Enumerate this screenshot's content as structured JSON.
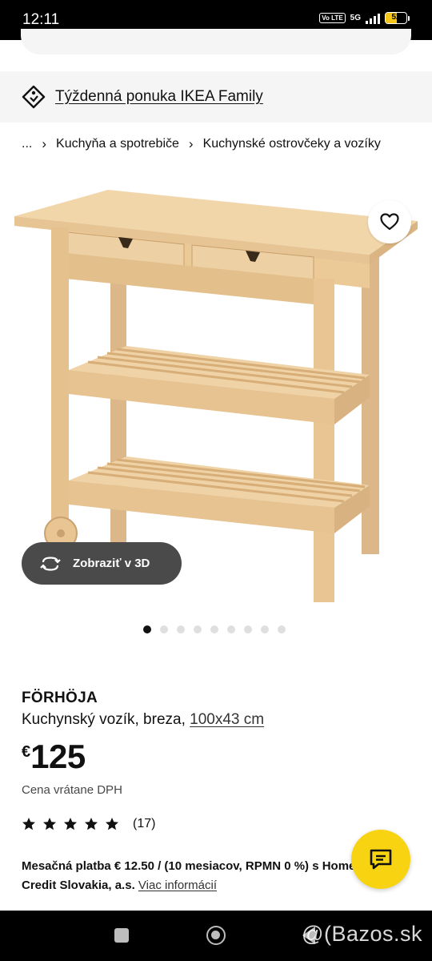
{
  "status_bar": {
    "time": "12:11",
    "volte": "Vo LTE",
    "network": "5G",
    "battery": "52",
    "battery_level": 0.52
  },
  "banner": {
    "link_label": "Týždenná ponuka IKEA Family",
    "icon": "price-tag-icon"
  },
  "breadcrumb": {
    "ellipsis": "...",
    "items": [
      "Kuchyňa a spotrebiče",
      "Kuchynské ostrovčeky a vozíky"
    ]
  },
  "gallery": {
    "view_3d_label": "Zobraziť v 3D",
    "dot_count": 9,
    "active_dot": 0
  },
  "product": {
    "name": "FÖRHÖJA",
    "description": "Kuchynský vozík, breza,",
    "dimensions": "100x43 cm",
    "currency": "€",
    "price": "125",
    "vat_note": "Cena vrátane DPH",
    "rating_stars": 5,
    "rating_count": "(17)",
    "installment_bold": "Mesačná platba € 12.50 / (10 mesiacov, RPMN 0 %) s Home Credit Slovakia, a.s.",
    "installment_link": "Viac informácií"
  },
  "nav": {
    "watermark": "@(Bazos.sk"
  },
  "colors": {
    "accent_yellow": "#f7d312",
    "dark_button": "#4a4a4a",
    "banner_bg": "#f5f5f5"
  }
}
